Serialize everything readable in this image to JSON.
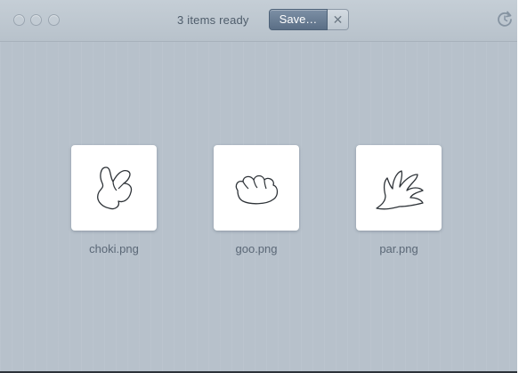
{
  "titlebar": {
    "status": "3 items ready",
    "save_label": "Save…",
    "cancel_glyph": "✕",
    "refresh_icon": "refresh-icon"
  },
  "files": [
    {
      "name": "choki.png",
      "icon": "scissors-hand-drawing"
    },
    {
      "name": "goo.png",
      "icon": "rock-fist-drawing"
    },
    {
      "name": "par.png",
      "icon": "paper-hand-drawing"
    }
  ],
  "colors": {
    "background": "#b6c0ca",
    "save_button": "#5b6f86",
    "text": "#4f5d6b"
  }
}
